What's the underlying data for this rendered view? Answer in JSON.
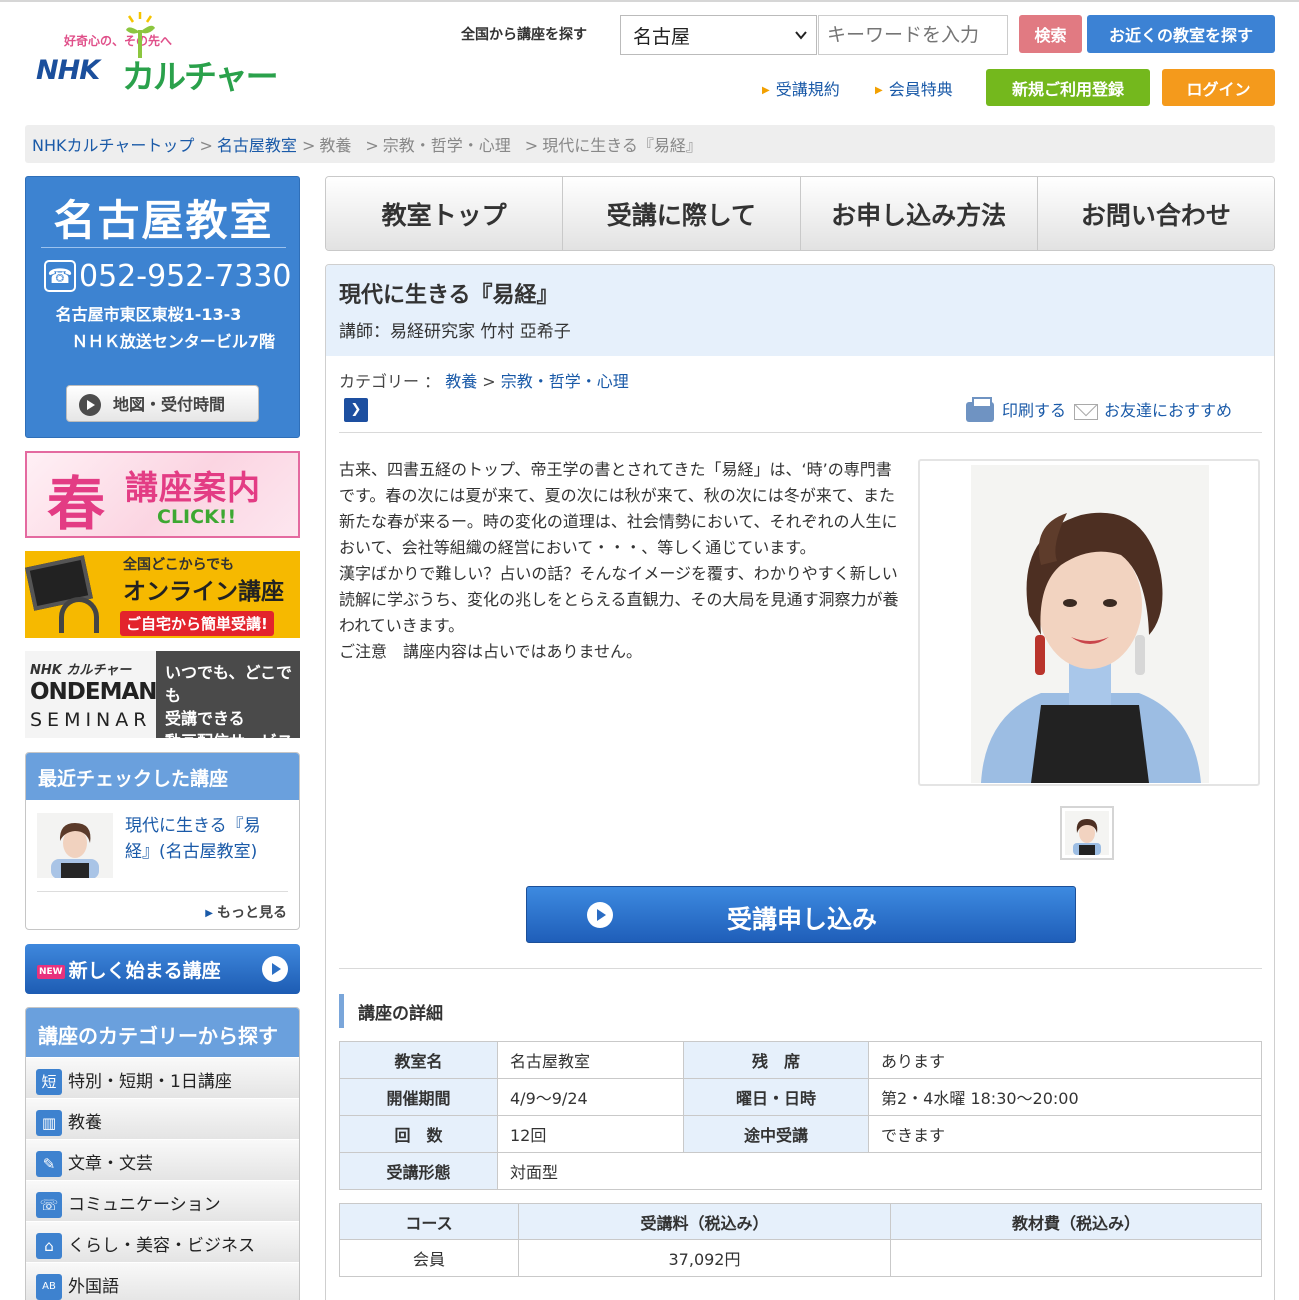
{
  "header": {
    "logo_tagline": "好奇心の、その先へ",
    "logo_nhk": "NHK",
    "logo_culture": "カルチャー",
    "search_label": "全国から講座を探す",
    "search_select_value": "名古屋",
    "search_placeholder": "キーワードを入力",
    "search_button": "検索",
    "near_button": "お近くの教室を探す",
    "links": [
      "受講規約",
      "会員特典"
    ],
    "register_button": "新規ご利用登録",
    "login_button": "ログイン",
    "colors": {
      "brand_blue": "#1b4f9c",
      "brand_green": "#2aa14b",
      "register": "#74b81d",
      "login": "#f49a1c",
      "search": "#e17a82",
      "near": "#3c82d4"
    }
  },
  "breadcrumb": {
    "top": "NHKカルチャートップ",
    "classroom": "名古屋教室",
    "cat1": "教養",
    "cat2": "宗教・哲学・心理",
    "current": "現代に生きる『易経』",
    "sep": ">"
  },
  "sidebar": {
    "classroom": {
      "name": "名古屋教室",
      "phone": "052-952-7330",
      "address1": "名古屋市東区東桜1-13-3",
      "address2": "ＮＨＫ放送センタービル7階",
      "map_button": "地図・受付時間"
    },
    "banner_spring": {
      "haru": "春",
      "main": "講座案内",
      "click": "CLICK!!"
    },
    "banner_online": {
      "top": "全国どこからでも",
      "main": "オンライン講座",
      "sub": "ご自宅から簡単受講!"
    },
    "banner_ondemand": {
      "nhk": "NHK カルチャー",
      "brand": "ONDEMAND",
      "seminar": "SEMINAR",
      "line1": "いつでも、どこでも",
      "line2": "受講できる",
      "line3": "動画配信サービス"
    },
    "recent": {
      "title": "最近チェックした講座",
      "item": "現代に生きる『易経』(名古屋教室)",
      "more": "もっと見る"
    },
    "new_courses": {
      "badge": "NEW",
      "label": "新しく始まる講座"
    },
    "categories": {
      "title": "講座のカテゴリーから探す",
      "items": [
        {
          "icon": "短",
          "label": "特別・短期・1日講座"
        },
        {
          "icon": "▥",
          "label": "教養"
        },
        {
          "icon": "✎",
          "label": "文章・文芸"
        },
        {
          "icon": "☏",
          "label": "コミュニケーション"
        },
        {
          "icon": "⌂",
          "label": "くらし・美容・ビジネス"
        },
        {
          "icon": "AB",
          "label": "外国語"
        }
      ]
    }
  },
  "nav": {
    "tabs": [
      "教室トップ",
      "受講に際して",
      "お申し込み方法",
      "お問い合わせ"
    ]
  },
  "course": {
    "title": "現代に生きる『易経』",
    "teacher": "講師：易経研究家 竹村 亞希子",
    "category_label": "カテゴリー ：",
    "category1": "教養",
    "category_sep": " > ",
    "category2": "宗教・哲学・心理",
    "print": "印刷する",
    "recommend": "お友達におすすめ",
    "description": [
      "古来、四書五経のトップ、帝王学の書とされてきた「易経」は、‘時’の専門書です。春の次には夏が来て、夏の次には秋が来て、秋の次には冬が来て、また新たな春が来るー。時の変化の道理は、社会情勢において、それぞれの人生において、会社等組織の経営において・・・、等しく通じています。",
      "漢字ばかりで難しい？占いの話？そんなイメージを覆す、わかりやすく新しい読解に学ぶうち、変化の兆しをとらえる直観力、その大局を見通す洞察力が養われていきます。",
      "",
      "ご注意　講座内容は占いではありません。"
    ],
    "apply_button": "受講申し込み",
    "detail_title": "講座の詳細",
    "details": {
      "classroom_label": "教室名",
      "classroom_value": "名古屋教室",
      "seats_label": "残　席",
      "seats_value": "あります",
      "period_label": "開催期間",
      "period_value": "4/9〜9/24",
      "schedule_label": "曜日・日時",
      "schedule_value": "第2・4水曜 18:30〜20:00",
      "count_label": "回　数",
      "count_value": "12回",
      "midway_label": "途中受講",
      "midway_value": "できます",
      "format_label": "受講形態",
      "format_value": "対面型"
    },
    "fees": {
      "headers": [
        "コース",
        "受講料（税込み）",
        "教材費（税込み）"
      ],
      "rows": [
        [
          "会員",
          "37,092円",
          ""
        ]
      ]
    }
  }
}
